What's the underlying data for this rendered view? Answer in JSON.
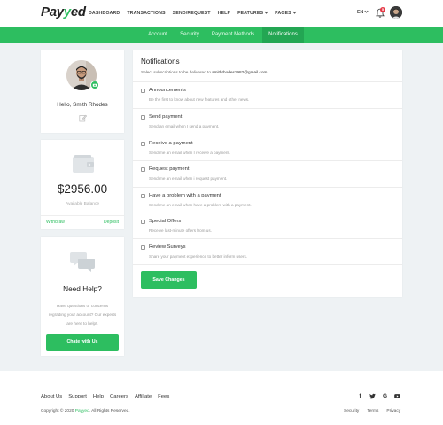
{
  "brand": {
    "prefix": "Pay",
    "accent": "y",
    "suffix": "ed",
    "accent_color": "#2dbe60"
  },
  "nav": {
    "items": [
      {
        "label": "DASHBOARD",
        "dropdown": false
      },
      {
        "label": "TRANSACTIONS",
        "dropdown": false
      },
      {
        "label": "SEND/REQUEST",
        "dropdown": false
      },
      {
        "label": "HELP",
        "dropdown": false
      },
      {
        "label": "FEATURES",
        "dropdown": true
      },
      {
        "label": "PAGES",
        "dropdown": true
      }
    ],
    "language": "EN",
    "notification_count": "5"
  },
  "tabs": [
    {
      "label": "Account",
      "active": false
    },
    {
      "label": "Security",
      "active": false
    },
    {
      "label": "Payment Methods",
      "active": false
    },
    {
      "label": "Notifications",
      "active": true
    }
  ],
  "profile": {
    "greeting": "Hello, Smith Rhodes"
  },
  "balance": {
    "amount": "$2956.00",
    "label": "Available Balance",
    "withdraw": "Withdraw",
    "deposit": "Deposit"
  },
  "help": {
    "title": "Need Help?",
    "text": "Have questions or concerns regrading your account? Our experts are here to help!.",
    "button": "Chate with Us"
  },
  "notifications": {
    "title": "Notifications",
    "subtitle": "Select subscriptions to be delivered to",
    "email": "smithrhodes1982@gmail.com",
    "items": [
      {
        "label": "Announcements",
        "desc": "Be the first to know about new features and other news."
      },
      {
        "label": "Send payment",
        "desc": "Send an email when I send a payment."
      },
      {
        "label": "Receive a payment",
        "desc": "Send me an email when I receive a payment."
      },
      {
        "label": "Request payment",
        "desc": "Send me an email when i request payment."
      },
      {
        "label": "Have a problem with a payment",
        "desc": "Send me an email when have a problem with a payment."
      },
      {
        "label": "Special Offers",
        "desc": "Receive last-minute offers from us."
      },
      {
        "label": "Review Surveys",
        "desc": "Share your payment experience to better inform users."
      }
    ],
    "save_button": "Save Changes"
  },
  "footer": {
    "links": [
      "About Us",
      "Support",
      "Help",
      "Careers",
      "Affiliate",
      "Fees"
    ],
    "copyright_prefix": "Copyright © 2020",
    "copyright_brand": "Payyed",
    "copyright_suffix": ". All Rights Reserved.",
    "legal": [
      "Security",
      "Terms",
      "Privacy"
    ],
    "socials": [
      "facebook-icon",
      "twitter-icon",
      "google-icon",
      "youtube-icon"
    ]
  }
}
